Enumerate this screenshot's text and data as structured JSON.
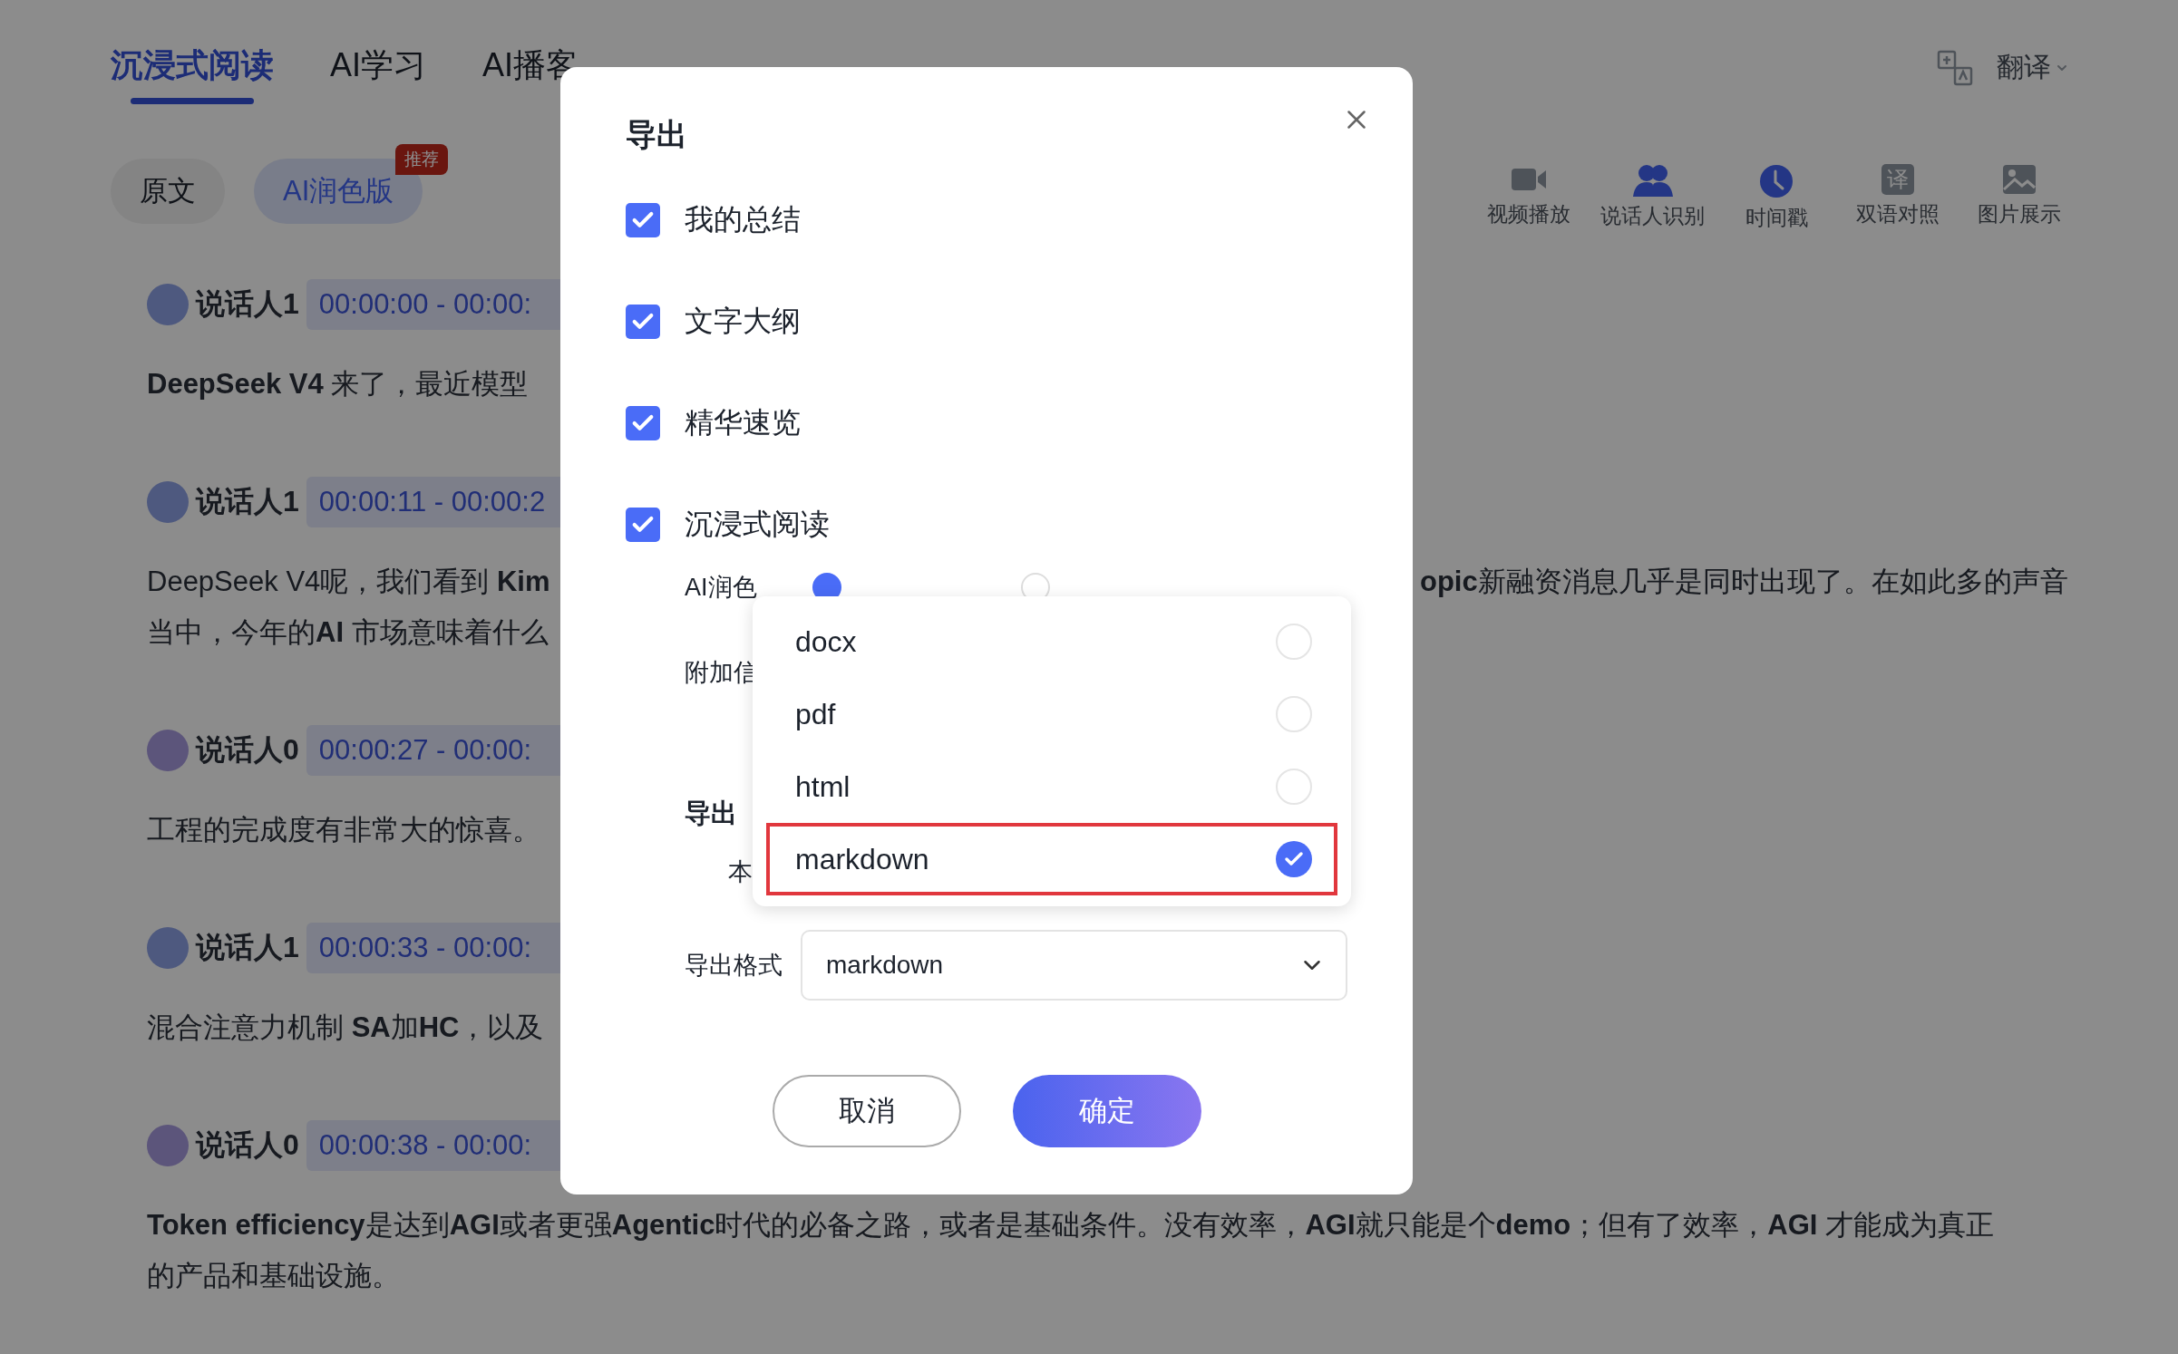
{
  "tabs": [
    {
      "label": "沉浸式阅读",
      "selected": true
    },
    {
      "label": "AI学习",
      "selected": false
    },
    {
      "label": "AI播客",
      "selected": false
    }
  ],
  "translate": {
    "label": "翻译"
  },
  "versions": [
    {
      "label": "原文",
      "selected": false
    },
    {
      "label": "AI润色版",
      "selected": true,
      "badge": "推荐"
    }
  ],
  "toolbar": [
    {
      "kind": "video",
      "label": "视频播放",
      "active": false
    },
    {
      "kind": "people",
      "label": "说话人识别",
      "active": true
    },
    {
      "kind": "clock",
      "label": "时间戳",
      "active": true
    },
    {
      "kind": "glyph",
      "glyph": "译",
      "label": "双语对照",
      "active": false
    },
    {
      "kind": "image",
      "label": "图片展示",
      "active": false
    }
  ],
  "segments": [
    {
      "speaker": "说话人1",
      "color": "#4e597f",
      "time": "00:00:00 - 00:00:",
      "lines": [
        {
          "left": "**DeepSeek V4** 来了，最近模型"
        }
      ]
    },
    {
      "speaker": "说话人1",
      "color": "#4e597f",
      "time": "00:00:11 - 00:00:2",
      "lines": [
        {
          "left": "DeepSeek V4呢，我们看到 **Kim**",
          "right": "**opic**新融资消息几乎是同时出现了。在如此多的声音"
        },
        {
          "left": "当中，今年的**AI** 市场意味着什么"
        }
      ]
    },
    {
      "speaker": "说话人0",
      "color": "#5c557b",
      "time": "00:00:27 - 00:00:",
      "lines": [
        {
          "left": "工程的完成度有非常大的惊喜。"
        }
      ]
    },
    {
      "speaker": "说话人1",
      "color": "#4e597f",
      "time": "00:00:33 - 00:00:",
      "lines": [
        {
          "left": "混合注意力机制 **SA**加**HC**，以及"
        }
      ]
    },
    {
      "speaker": "说话人0",
      "color": "#5c557b",
      "time": "00:00:38 - 00:00:",
      "lines": [
        {
          "left": "**Token efficiency**是达到**AGI**或者更强**Agentic**时代的必备之路，或者是基础条件。没有效率，**AGI**就只能是个**demo**；但有了效率，**AGI** 才能成为真正"
        },
        {
          "left": "的产品和基础设施。"
        }
      ]
    }
  ],
  "dialog": {
    "title": "导出",
    "sections": [
      {
        "label": "我的总结",
        "checked": true
      },
      {
        "label": "文字大纲",
        "checked": true
      },
      {
        "label": "精华速览",
        "checked": true
      },
      {
        "label": "沉浸式阅读",
        "checked": true
      }
    ],
    "version_label": "AI润色",
    "version_options": [
      {
        "selected": true
      },
      {
        "selected": false
      }
    ],
    "extra_label": "附加信",
    "export_to_heading": "导出",
    "export_to_option": "本",
    "format_label": "导出格式",
    "format_value": "markdown",
    "format_options": [
      {
        "label": "docx",
        "selected": false,
        "outlined": false
      },
      {
        "label": "pdf",
        "selected": false,
        "outlined": false
      },
      {
        "label": "html",
        "selected": false,
        "outlined": false
      },
      {
        "label": "markdown",
        "selected": true,
        "outlined": true
      }
    ],
    "buttons": [
      {
        "kind": "secondary",
        "label": "取消"
      },
      {
        "kind": "primary",
        "label": "确定"
      }
    ]
  }
}
